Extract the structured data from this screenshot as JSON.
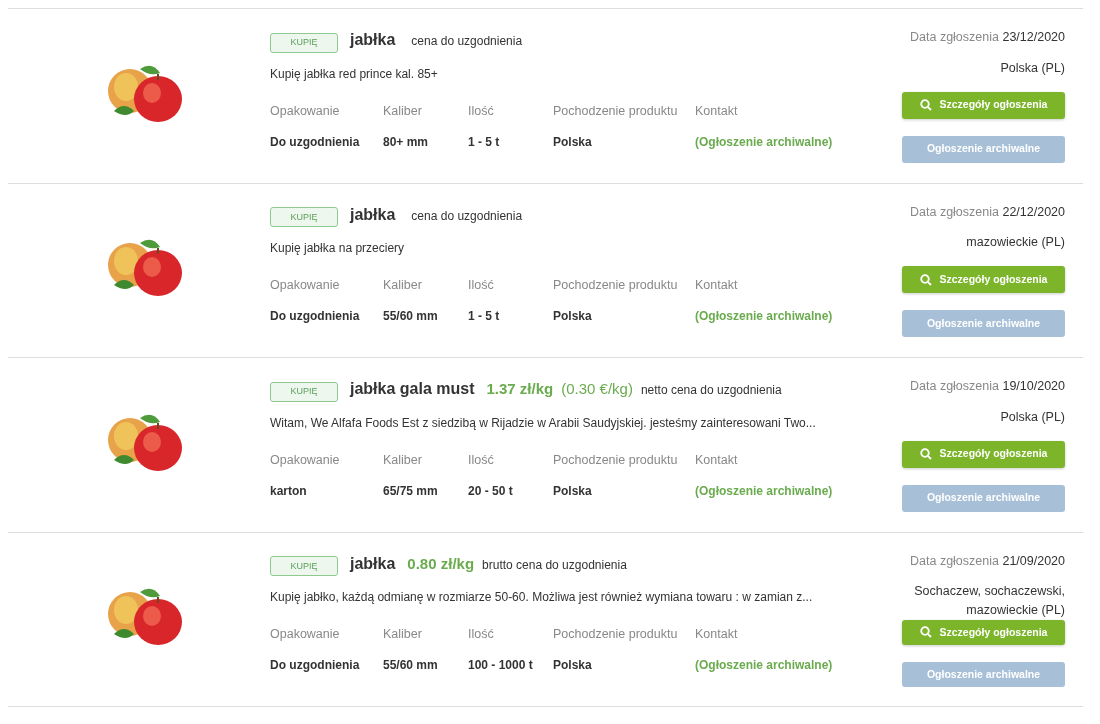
{
  "listings": [
    {
      "badge": "KUPIĘ",
      "title": "jabłka",
      "negotiable": "cena do uzgodnienia",
      "description": "Kupię jabłka red prince kal. 85+",
      "date_label": "Data zgłoszenia",
      "date": "23/12/2020",
      "location": "Polska (PL)",
      "fields": [
        {
          "label": "Opakowanie",
          "value": "Do uzgodnienia"
        },
        {
          "label": "Kaliber",
          "value": "80+ mm"
        },
        {
          "label": "Ilość",
          "value": "1 - 5 t"
        },
        {
          "label": "Pochodzenie produktu",
          "value": "Polska"
        },
        {
          "label": "Kontakt",
          "value": "(Ogłoszenie archiwalne)",
          "kind": "link"
        }
      ],
      "details_button": "Szczegóły ogłoszenia",
      "archive_button": "Ogłoszenie archiwalne"
    },
    {
      "badge": "KUPIĘ",
      "title": "jabłka",
      "negotiable": "cena do uzgodnienia",
      "description": "Kupię jabłka na przeciery",
      "date_label": "Data zgłoszenia",
      "date": "22/12/2020",
      "location": "mazowieckie (PL)",
      "fields": [
        {
          "label": "Opakowanie",
          "value": "Do uzgodnienia"
        },
        {
          "label": "Kaliber",
          "value": "55/60 mm"
        },
        {
          "label": "Ilość",
          "value": "1 - 5 t"
        },
        {
          "label": "Pochodzenie produktu",
          "value": "Polska"
        },
        {
          "label": "Kontakt",
          "value": "(Ogłoszenie archiwalne)",
          "kind": "link"
        }
      ],
      "details_button": "Szczegóły ogłoszenia",
      "archive_button": "Ogłoszenie archiwalne"
    },
    {
      "badge": "KUPIĘ",
      "title": "jabłka gala must",
      "price": "1.37 zł/kg",
      "price_alt": "(0.30 €/kg)",
      "price_type": "netto",
      "negotiable": "cena do uzgodnienia",
      "description": "Witam, We Alfafa Foods Est z siedzibą w Rijadzie w Arabii Saudyjskiej. jesteśmy zainteresowani Two...",
      "date_label": "Data zgłoszenia",
      "date": "19/10/2020",
      "location": "Polska (PL)",
      "fields": [
        {
          "label": "Opakowanie",
          "value": "karton"
        },
        {
          "label": "Kaliber",
          "value": "65/75 mm"
        },
        {
          "label": "Ilość",
          "value": "20 - 50 t"
        },
        {
          "label": "Pochodzenie produktu",
          "value": "Polska"
        },
        {
          "label": "Kontakt",
          "value": "(Ogłoszenie archiwalne)",
          "kind": "link"
        }
      ],
      "details_button": "Szczegóły ogłoszenia",
      "archive_button": "Ogłoszenie archiwalne"
    },
    {
      "badge": "KUPIĘ",
      "title": "jabłka",
      "price": "0.80 zł/kg",
      "price_type": "brutto",
      "negotiable": "cena do uzgodnienia",
      "description": "Kupię jabłko, każdą odmianę w rozmiarze 50-60. Możliwa jest również wymiana towaru : w zamian z...",
      "date_label": "Data zgłoszenia",
      "date": "21/09/2020",
      "location": "Sochaczew, sochaczewski, mazowieckie (PL)",
      "fields": [
        {
          "label": "Opakowanie",
          "value": "Do uzgodnienia"
        },
        {
          "label": "Kaliber",
          "value": "55/60 mm"
        },
        {
          "label": "Ilość",
          "value": "100 - 1000 t"
        },
        {
          "label": "Pochodzenie produktu",
          "value": "Polska"
        },
        {
          "label": "Kontakt",
          "value": "(Ogłoszenie archiwalne)",
          "kind": "link"
        }
      ],
      "details_button": "Szczegóły ogłoszenia",
      "archive_button": "Ogłoszenie archiwalne"
    }
  ]
}
